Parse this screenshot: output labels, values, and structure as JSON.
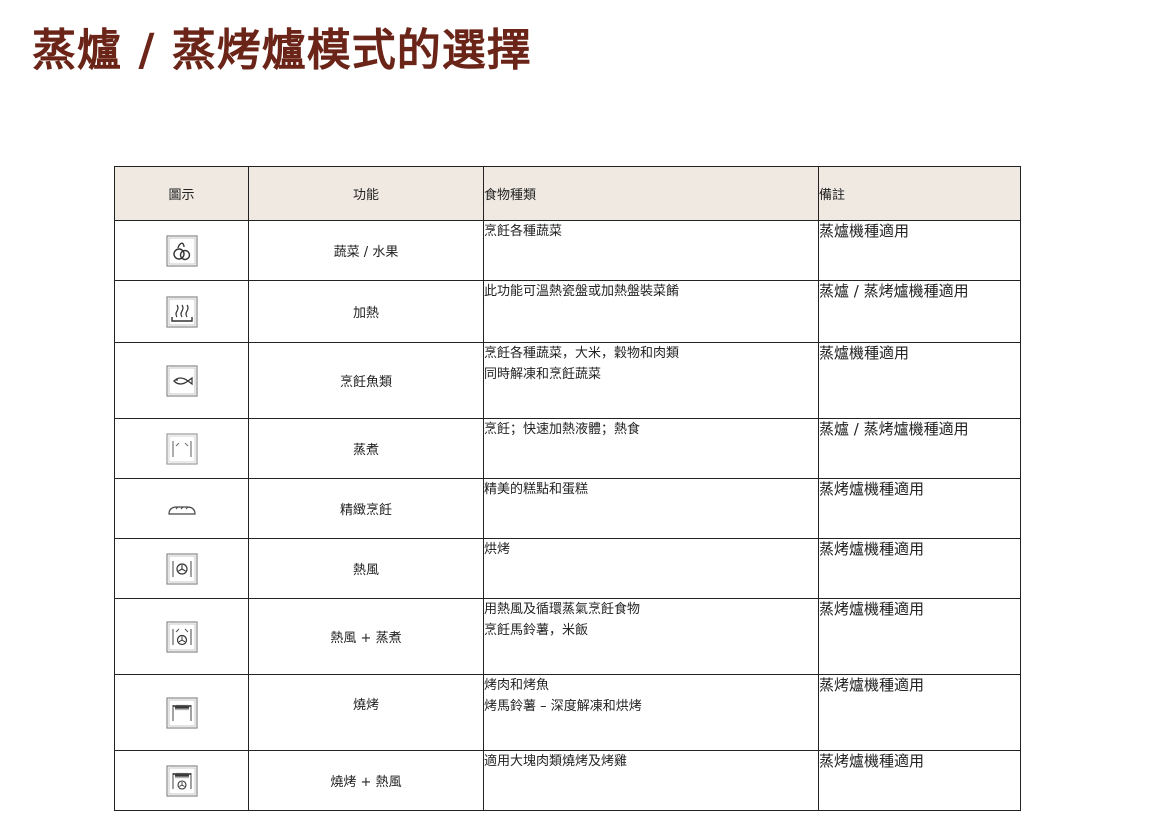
{
  "title": "蒸爐 / 蒸烤爐模式的選擇",
  "table": {
    "headers": {
      "icon": "圖示",
      "function": "功能",
      "food": "食物種類",
      "note": "備註"
    },
    "rows": [
      {
        "icon": "vegetable-fruit-icon",
        "function": "蔬菜 / 水果",
        "food": [
          "烹飪各種蔬菜"
        ],
        "note": "蒸爐機種適用"
      },
      {
        "icon": "warming-plate-icon",
        "function": "加熱",
        "food": [
          "此功能可溫熱瓷盤或加熱盤裝菜餚"
        ],
        "note": "蒸爐 / 蒸烤爐機種適用"
      },
      {
        "icon": "fish-icon",
        "function": "烹飪魚類",
        "food": [
          "烹飪各種蔬菜，大米，穀物和肉類",
          "同時解凍和烹飪蔬菜"
        ],
        "note": "蒸爐機種適用"
      },
      {
        "icon": "steam-icon",
        "function": "蒸煮",
        "food": [
          "烹飪；快速加熱液體；熱食"
        ],
        "note": "蒸爐 / 蒸烤爐機種適用"
      },
      {
        "icon": "bread-icon",
        "function": "精緻烹飪",
        "food": [
          "精美的糕點和蛋糕"
        ],
        "note": "蒸烤爐機種適用"
      },
      {
        "icon": "fan-icon",
        "function": "熱風",
        "food": [
          "烘烤"
        ],
        "note": "蒸烤爐機種適用"
      },
      {
        "icon": "fan-steam-icon",
        "function": "熱風 + 蒸煮",
        "food": [
          "用熱風及循環蒸氣烹飪食物",
          "烹飪馬鈴薯，米飯"
        ],
        "note": "蒸烤爐機種適用"
      },
      {
        "icon": "grill-icon",
        "function": "燒烤",
        "food": [
          "烤肉和烤魚",
          "烤馬鈴薯 – 深度解凍和烘烤"
        ],
        "note": "蒸烤爐機種適用"
      },
      {
        "icon": "grill-fan-icon",
        "function": "燒烤 + 熱風",
        "food": [
          "適用大塊肉類燒烤及烤雞"
        ],
        "note": "蒸烤爐機種適用"
      }
    ]
  }
}
